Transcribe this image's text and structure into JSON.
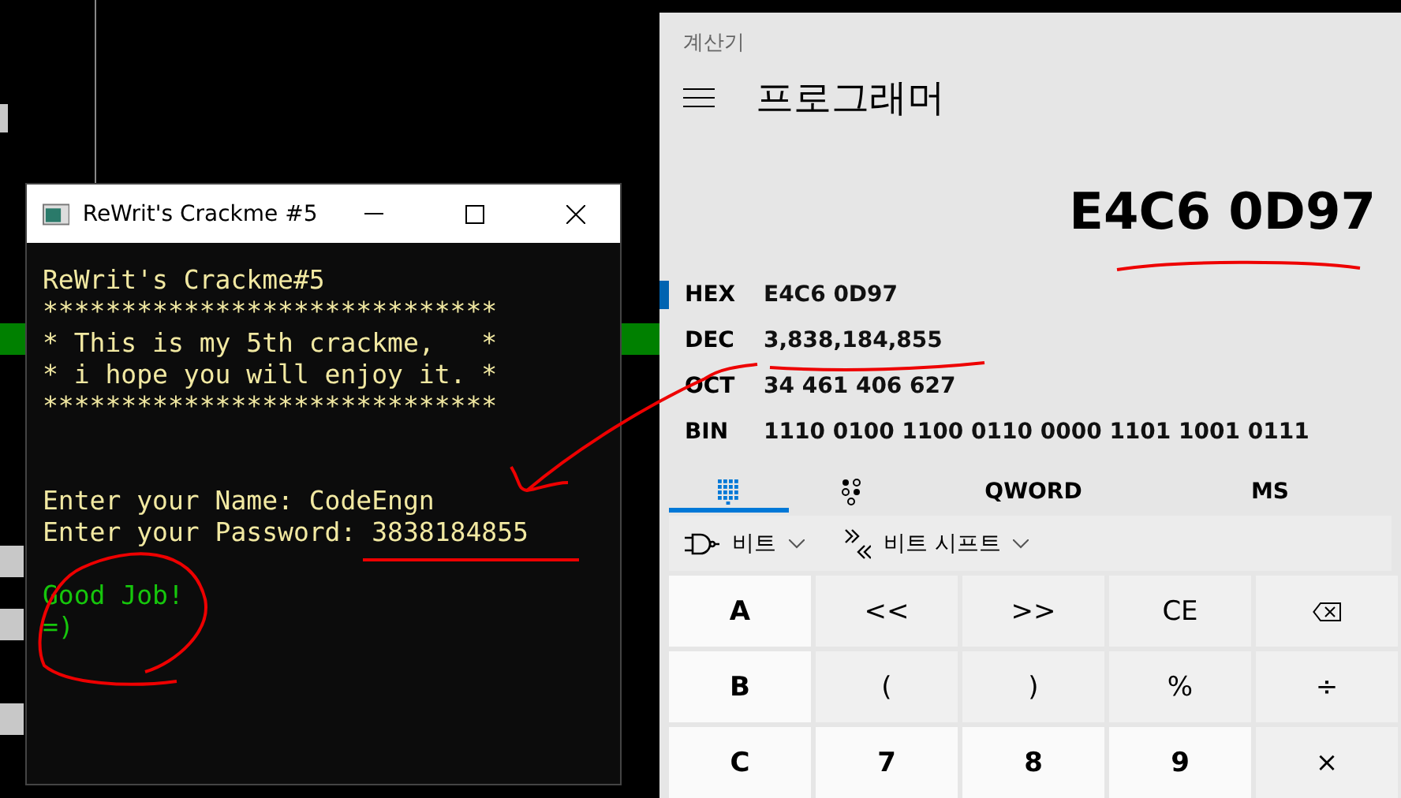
{
  "console_window": {
    "title": "ReWrit's Crackme #5",
    "blocks": [
      {
        "kind": "banner",
        "color": "#f2e9a2",
        "lines": [
          "ReWrit's Crackme#5",
          "*****************************",
          "* This is my 5th crackme,   *",
          "* i hope you will enjoy it. *",
          "*****************************"
        ]
      },
      {
        "kind": "prompt",
        "color": "#f2e9a2",
        "lines": [
          "Enter your Name: CodeEngn",
          "Enter your Password: 3838184855"
        ]
      },
      {
        "kind": "result",
        "color": "#16c60c",
        "lines": [
          "Good Job!",
          "=)"
        ]
      }
    ]
  },
  "calculator": {
    "app_title": "계산기",
    "mode_title": "프로그래머",
    "display": "E4C6 0D97",
    "bases": [
      {
        "label": "HEX",
        "value": "E4C6 0D97",
        "selected": true
      },
      {
        "label": "DEC",
        "value": "3,838,184,855",
        "selected": false
      },
      {
        "label": "OCT",
        "value": "34 461 406 627",
        "selected": false
      },
      {
        "label": "BIN",
        "value": "1110 0100 1100 0110 0000 1101 1001 0111",
        "selected": false
      }
    ],
    "tabs": [
      {
        "kind": "keypad",
        "selected": true
      },
      {
        "kind": "bits",
        "selected": false
      },
      {
        "kind": "text",
        "label": "QWORD",
        "selected": false
      },
      {
        "kind": "text",
        "label": "MS",
        "selected": false
      }
    ],
    "tools": [
      {
        "kind": "gate",
        "label": "비트"
      },
      {
        "kind": "shift",
        "label": "비트 시프트"
      }
    ],
    "keys": [
      {
        "kind": "letter",
        "label": "A"
      },
      {
        "kind": "operator",
        "label": "<<"
      },
      {
        "kind": "operator",
        "label": ">>"
      },
      {
        "kind": "operator",
        "label": "CE"
      },
      {
        "kind": "backspace"
      },
      {
        "kind": "letter",
        "label": "B"
      },
      {
        "kind": "operator",
        "label": "("
      },
      {
        "kind": "operator",
        "label": ")"
      },
      {
        "kind": "operator",
        "label": "%"
      },
      {
        "kind": "operator",
        "label": "÷"
      },
      {
        "kind": "letter",
        "label": "C"
      },
      {
        "kind": "digit",
        "label": "7"
      },
      {
        "kind": "digit",
        "label": "8"
      },
      {
        "kind": "digit",
        "label": "9"
      },
      {
        "kind": "operator",
        "label": "×"
      }
    ]
  }
}
